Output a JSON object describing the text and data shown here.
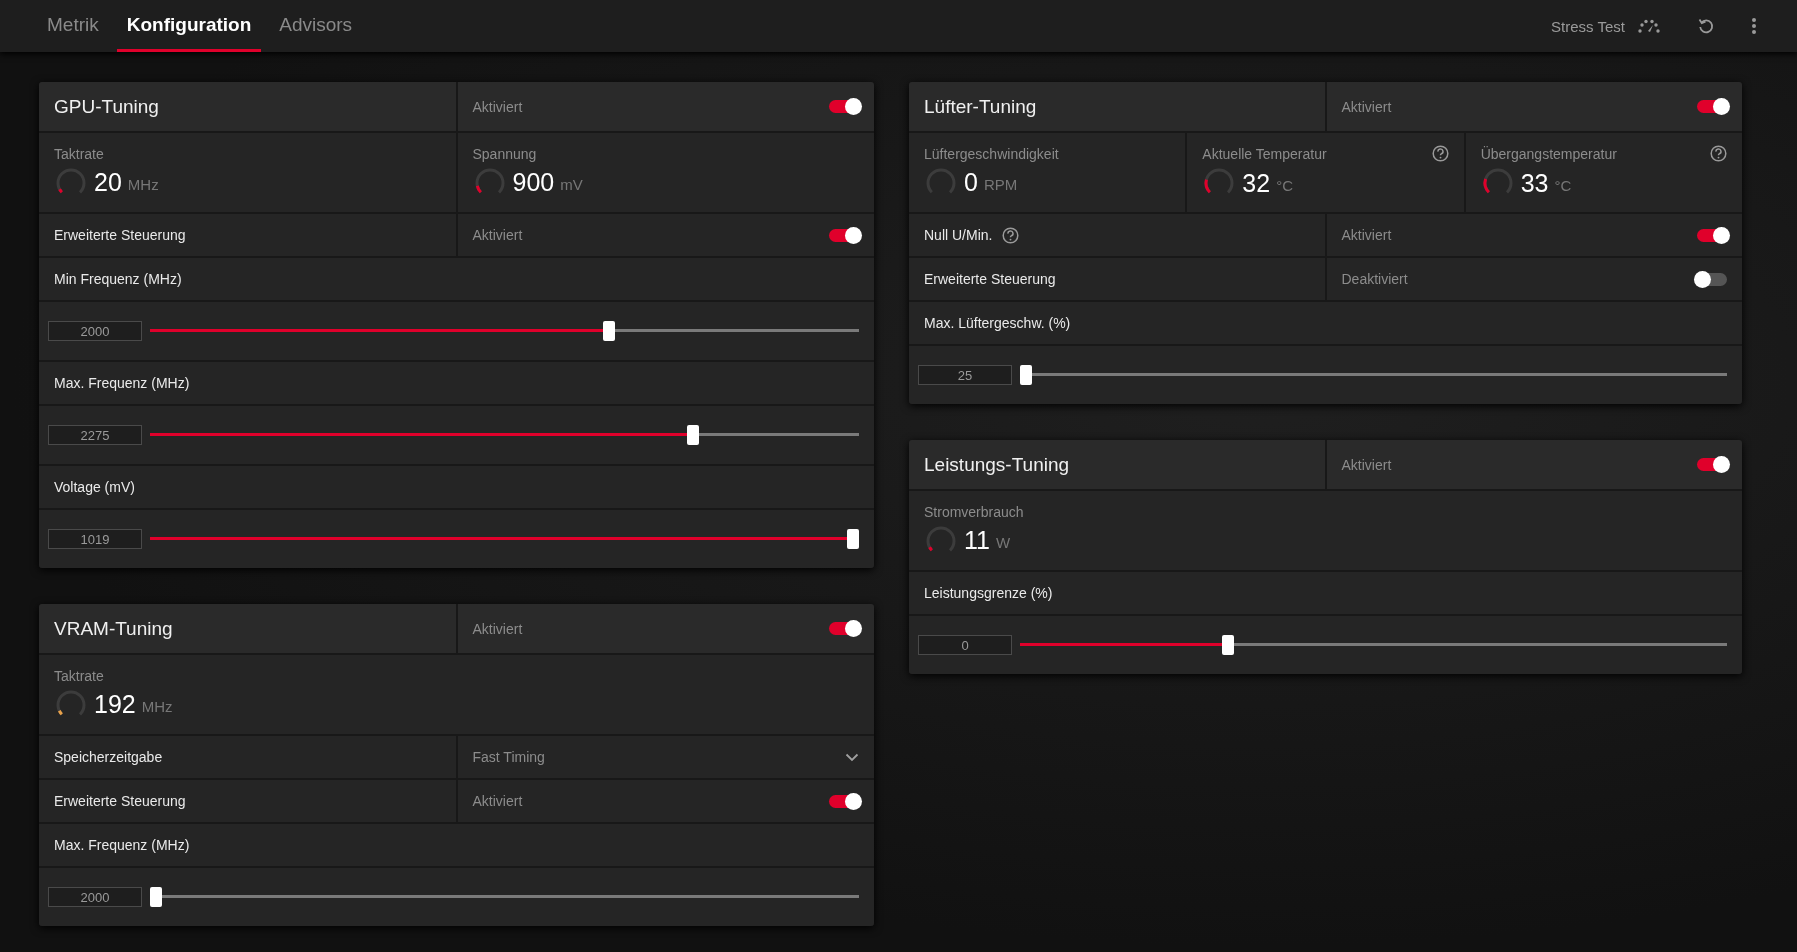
{
  "tabs": [
    {
      "label": "Metrik",
      "selected": false
    },
    {
      "label": "Konfiguration",
      "selected": true
    },
    {
      "label": "Advisors",
      "selected": false
    }
  ],
  "toolbar": {
    "stress_test": "Stress Test"
  },
  "left_column": {
    "cards": [
      {
        "title": "GPU-Tuning",
        "status": "Aktiviert",
        "on": true,
        "rows": [
          {
            "kind": "metrics",
            "items": [
              {
                "label": "Taktrate",
                "value": "20",
                "unit": "MHz",
                "level": 0.06,
                "color": "#e0002b"
              },
              {
                "label": "Spannung",
                "value": "900",
                "unit": "mV",
                "level": 0.12,
                "color": "#e0002b"
              }
            ]
          },
          {
            "kind": "toggle",
            "label": "Erweiterte Steuerung",
            "status": "Aktiviert",
            "on": true
          },
          {
            "kind": "label",
            "label": "Min Frequenz (MHz)"
          },
          {
            "kind": "slider",
            "value": "2000",
            "level": 0.65
          },
          {
            "kind": "label",
            "label": "Max. Frequenz (MHz)"
          },
          {
            "kind": "slider",
            "value": "2275",
            "level": 0.77
          },
          {
            "kind": "label",
            "label": "Voltage (mV)"
          },
          {
            "kind": "slider",
            "value": "1019",
            "level": 1
          }
        ]
      },
      {
        "title": "VRAM-Tuning",
        "status": "Aktiviert",
        "on": true,
        "rows": [
          {
            "kind": "metrics",
            "items": [
              {
                "label": "Taktrate",
                "value": "192",
                "unit": "MHz",
                "level": 0.07,
                "color": "#e8a14a"
              }
            ]
          },
          {
            "kind": "dropdown",
            "label": "Speicherzeitgabe",
            "status": "Fast Timing"
          },
          {
            "kind": "toggle",
            "label": "Erweiterte Steuerung",
            "status": "Aktiviert",
            "on": true
          },
          {
            "kind": "label",
            "label": "Max. Frequenz (MHz)"
          },
          {
            "kind": "slider",
            "value": "2000",
            "level": 0
          }
        ]
      }
    ]
  },
  "right_column": {
    "cards": [
      {
        "title": "Lüfter-Tuning",
        "status": "Aktiviert",
        "on": true,
        "rows": [
          {
            "kind": "metrics",
            "items": [
              {
                "label": "Lüftergeschwindigkeit",
                "value": "0",
                "unit": "RPM",
                "level": 0
              },
              {
                "label": "Aktuelle Temperatur",
                "value": "32",
                "unit": "°C",
                "level": 0.22,
                "color": "#e0002b",
                "help": true
              },
              {
                "label": "Übergangstemperatur",
                "value": "33",
                "unit": "°C",
                "level": 0.23,
                "color": "#e0002b",
                "help": true
              }
            ]
          },
          {
            "kind": "toggle",
            "label": "Null U/Min.",
            "help": true,
            "status": "Aktiviert",
            "on": true
          },
          {
            "kind": "toggle",
            "label": "Erweiterte Steuerung",
            "status": "Deaktiviert",
            "on": false
          },
          {
            "kind": "label",
            "label": "Max. Lüftergeschw. (%)"
          },
          {
            "kind": "slider",
            "value": "25",
            "level": 0
          }
        ]
      },
      {
        "title": "Leistungs-Tuning",
        "status": "Aktiviert",
        "on": true,
        "rows": [
          {
            "kind": "metrics",
            "items": [
              {
                "label": "Stromverbrauch",
                "value": "11",
                "unit": "W",
                "level": 0.06,
                "color": "#e0002b"
              }
            ]
          },
          {
            "kind": "label",
            "label": "Leistungsgrenze (%)"
          },
          {
            "kind": "slider",
            "value": "0",
            "level": 0.29
          }
        ]
      }
    ]
  }
}
